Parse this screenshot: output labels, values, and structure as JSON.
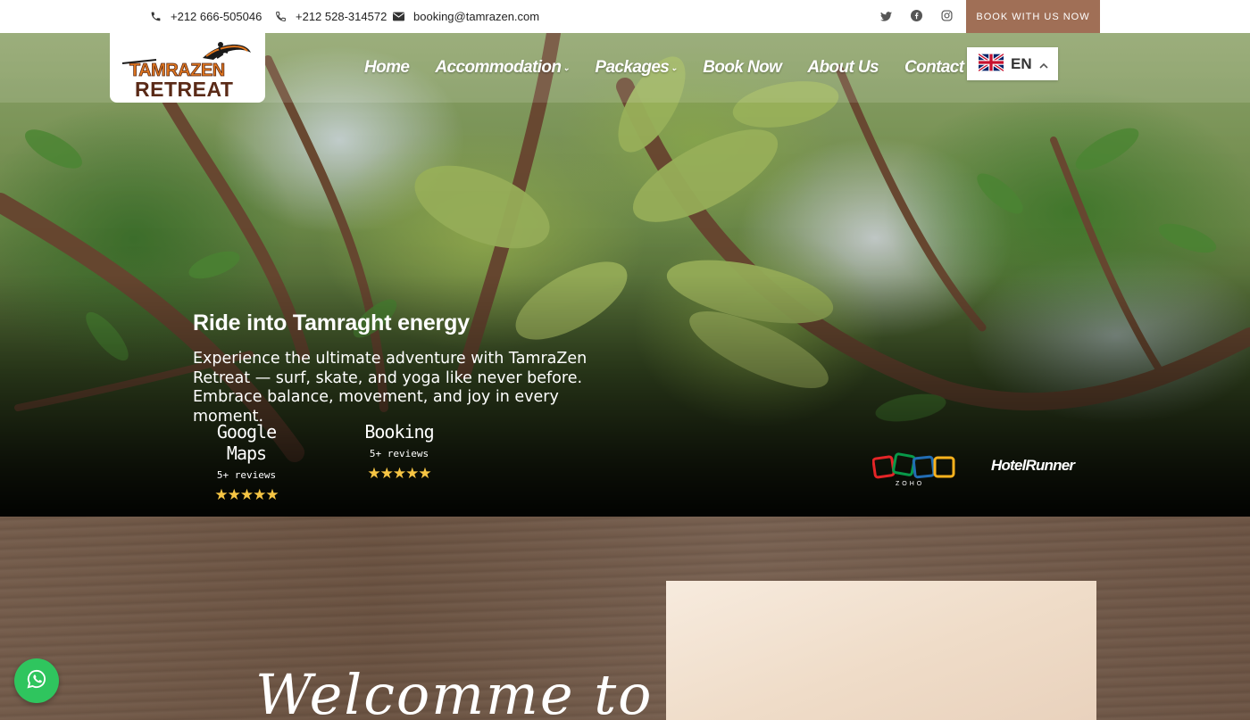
{
  "topbar": {
    "phone1": "+212 666-505046",
    "phone2": "+212 528-314572",
    "email": "booking@tamrazen.com",
    "social_icons": [
      "twitter-icon",
      "facebook-icon",
      "instagram-icon"
    ],
    "book_button": "BOOK WITH US NOW"
  },
  "logo": {
    "line1": "TAMRAZEN",
    "line2": "RETREAT"
  },
  "nav": {
    "items": [
      {
        "label": "Home",
        "has_dropdown": false
      },
      {
        "label": "Accommodation",
        "has_dropdown": true
      },
      {
        "label": "Packages",
        "has_dropdown": true
      },
      {
        "label": "Book Now",
        "has_dropdown": false
      },
      {
        "label": "About Us",
        "has_dropdown": false
      },
      {
        "label": "Contact Us",
        "has_dropdown": false
      }
    ]
  },
  "language": {
    "code": "EN",
    "flag": "uk-flag-icon"
  },
  "hero": {
    "title": "Ride into Tamraght energy",
    "subtitle": "Experience the ultimate adventure with TamraZen Retreat — surf, skate, and yoga like never before. Embrace balance, movement, and joy in every moment."
  },
  "reviews": [
    {
      "name": "Google Maps",
      "count": "5+ reviews",
      "stars": "★★★★★"
    },
    {
      "name": "Booking",
      "count": "5+ reviews",
      "stars": "★★★★★"
    }
  ],
  "partners": {
    "zoho": "ZOHO",
    "hotelrunner": "HotelRunner"
  },
  "welcome": {
    "text": "Welcomme to"
  },
  "colors": {
    "accent": "#a06f56",
    "whatsapp": "#2fc55e",
    "star": "#f6c544",
    "logo_orange": "#e3781f",
    "logo_brown": "#5a2a17"
  }
}
